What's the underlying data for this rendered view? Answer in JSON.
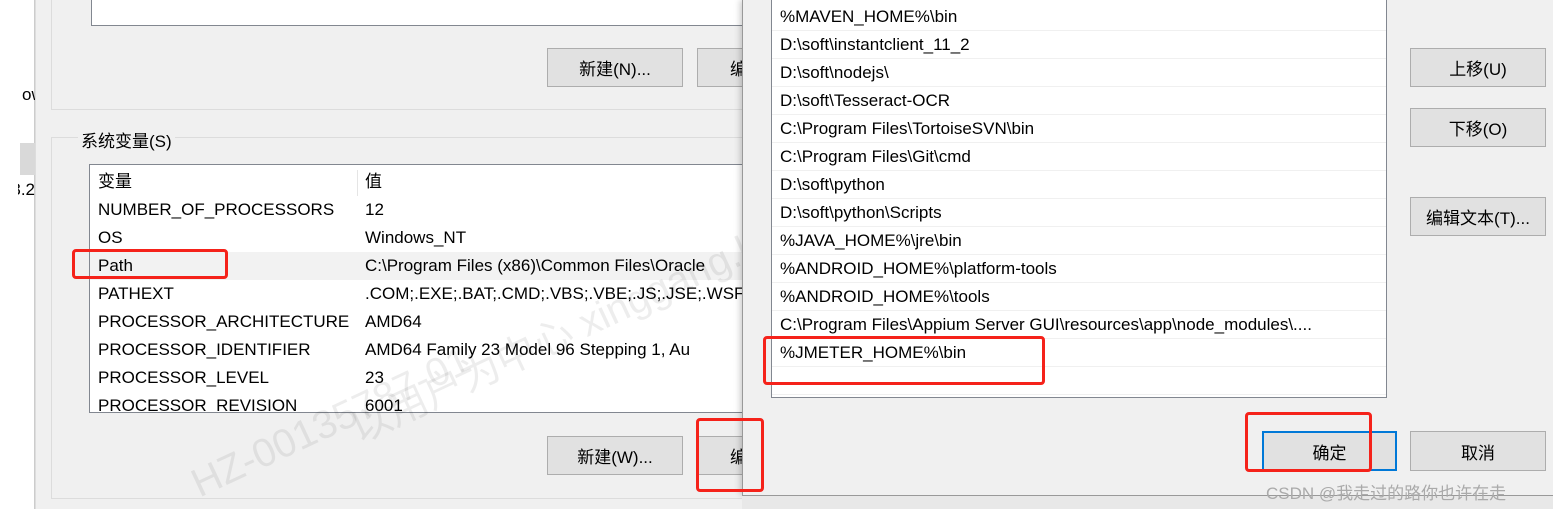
{
  "left_strip": {
    "text_1": "ow",
    "text_2": "3.2"
  },
  "user_vars": {
    "new_button": "新建(N)...",
    "edit_button": "编"
  },
  "system_vars": {
    "group_label": "系统变量(S)",
    "columns": [
      "变量",
      "值"
    ],
    "rows": [
      [
        "NUMBER_OF_PROCESSORS",
        "12"
      ],
      [
        "OS",
        "Windows_NT"
      ],
      [
        "Path",
        "C:\\Program Files (x86)\\Common Files\\Oracle"
      ],
      [
        "PATHEXT",
        ".COM;.EXE;.BAT;.CMD;.VBS;.VBE;.JS;.JSE;.WSF;."
      ],
      [
        "PROCESSOR_ARCHITECTURE",
        "AMD64"
      ],
      [
        "PROCESSOR_IDENTIFIER",
        "AMD64 Family 23 Model 96 Stepping 1, Au"
      ],
      [
        "PROCESSOR_LEVEL",
        "23"
      ],
      [
        "PROCESSOR_REVISION",
        "6001"
      ]
    ],
    "selected_row": "Path",
    "new_button": "新建(W)...",
    "edit_button": "编"
  },
  "edit_dialog": {
    "path_entries": [
      "%MAVEN_HOME%\\bin",
      "D:\\soft\\instantclient_11_2",
      "D:\\soft\\nodejs\\",
      "D:\\soft\\Tesseract-OCR",
      "C:\\Program Files\\TortoiseSVN\\bin",
      "C:\\Program Files\\Git\\cmd",
      "D:\\soft\\python",
      "D:\\soft\\python\\Scripts",
      "%JAVA_HOME%\\jre\\bin",
      "%ANDROID_HOME%\\platform-tools",
      "%ANDROID_HOME%\\tools",
      "C:\\Program Files\\Appium Server GUI\\resources\\app\\node_modules\\....",
      "%JMETER_HOME%\\bin",
      ""
    ],
    "move_up": "上移(U)",
    "move_down": "下移(O)",
    "edit_text": "编辑文本(T)...",
    "ok": "确定",
    "cancel": "取消"
  },
  "watermark": "CSDN @我走过的路你也许在走",
  "highlight_color": "#f5221a"
}
